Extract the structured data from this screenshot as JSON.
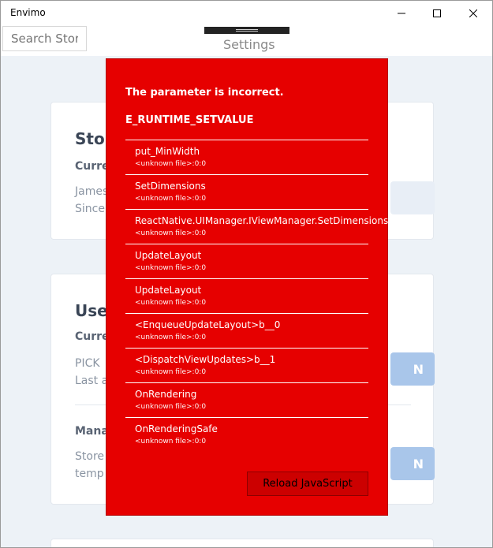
{
  "window": {
    "title": "Envimo"
  },
  "search": {
    "placeholder": "Search Stores"
  },
  "header": {
    "title": "Settings"
  },
  "cards": [
    {
      "title": "Stor",
      "subtitle": "Curre",
      "lines": [
        "James",
        "Since"
      ]
    },
    {
      "title": "Use",
      "subtitle": "Curre",
      "lines": [
        "PICK",
        "Last a"
      ],
      "button_label": "N"
    },
    {
      "subtitle": "Mana",
      "lines": [
        "Store",
        "temp"
      ],
      "button_label": "N"
    }
  ],
  "error": {
    "message": "The parameter is incorrect.",
    "code": "E_RUNTIME_SETVALUE",
    "frames": [
      {
        "name": "put_MinWidth",
        "location": "<unknown file>:0:0"
      },
      {
        "name": "SetDimensions",
        "location": "<unknown file>:0:0"
      },
      {
        "name": "ReactNative.UIManager.IViewManager.SetDimensions",
        "location": "<unknown file>:0:0"
      },
      {
        "name": "UpdateLayout",
        "location": "<unknown file>:0:0"
      },
      {
        "name": "UpdateLayout",
        "location": "<unknown file>:0:0"
      },
      {
        "name": "<EnqueueUpdateLayout>b__0",
        "location": "<unknown file>:0:0"
      },
      {
        "name": "<DispatchViewUpdates>b__1",
        "location": "<unknown file>:0:0"
      },
      {
        "name": "OnRendering",
        "location": "<unknown file>:0:0"
      },
      {
        "name": "OnRenderingSafe",
        "location": "<unknown file>:0:0"
      }
    ],
    "reload_label": "Reload JavaScript"
  }
}
